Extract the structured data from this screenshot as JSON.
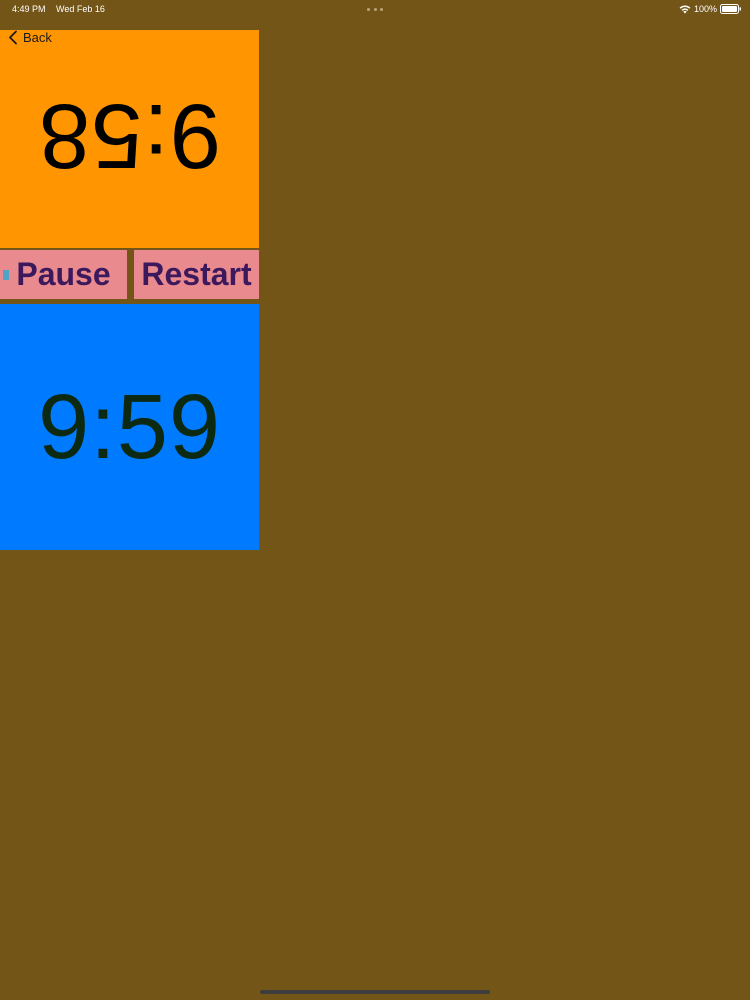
{
  "status_bar": {
    "time": "4:49 PM",
    "date": "Wed Feb 16",
    "battery_percent": "100%",
    "icons": [
      "wifi-icon",
      "battery-icon"
    ]
  },
  "nav": {
    "back_label": "Back",
    "back_icon": "chevron-left-icon"
  },
  "timers": {
    "top": {
      "value": "9:58",
      "orientation": "rotated-180",
      "color": "#ff9500"
    },
    "bottom": {
      "value": "9:59",
      "orientation": "upright",
      "color": "#007aff"
    }
  },
  "controls": {
    "pause_label": "Pause",
    "restart_label": "Restart",
    "button_color": "#e98a8e",
    "text_color": "#3c185c"
  },
  "colors": {
    "background": "#735518"
  }
}
